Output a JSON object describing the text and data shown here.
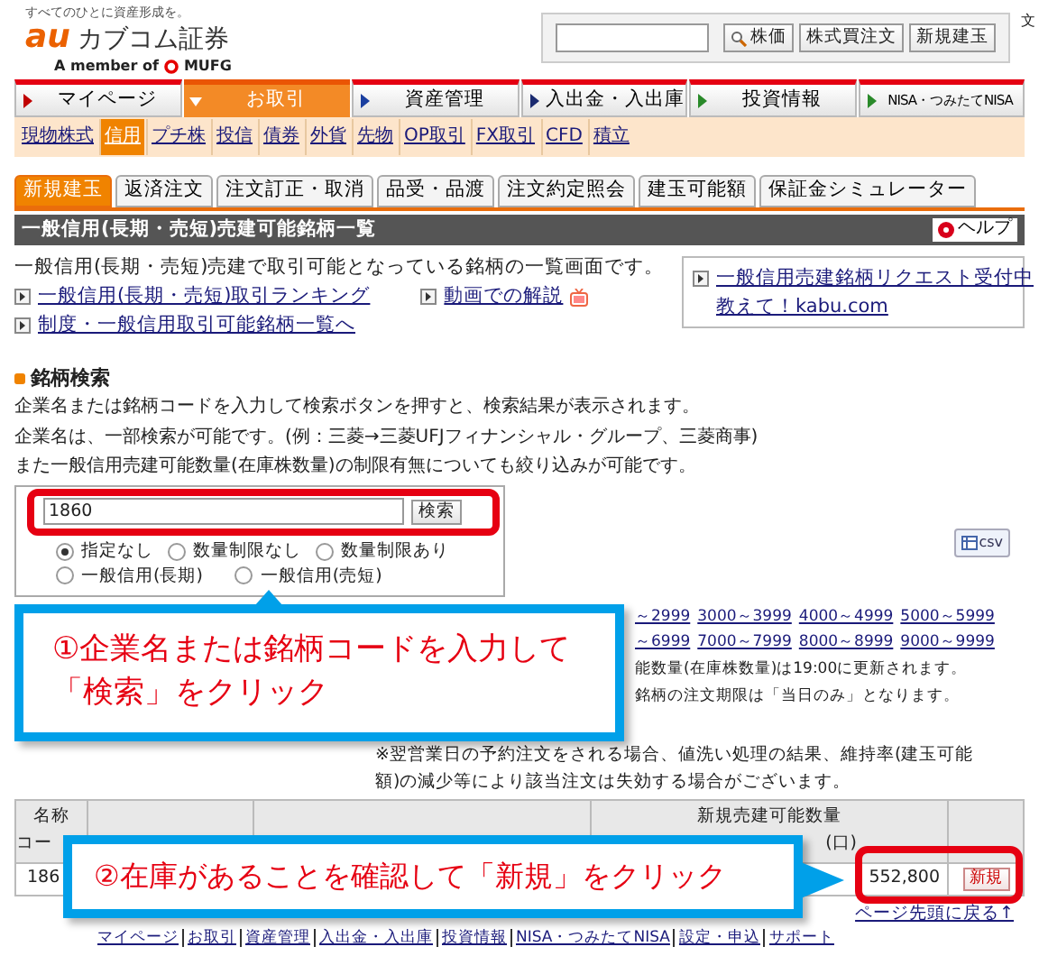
{
  "header": {
    "tagline": "すべてのひとに資産形成を。",
    "logo_mark": "au",
    "logo_text": "カブコム証券",
    "member_text": "A member of",
    "member_brand": "MUFG",
    "search_buttons": [
      "株価",
      "株式買注文",
      "新規建玉"
    ],
    "edge_texts": [
      "文"
    ]
  },
  "main_nav": [
    {
      "label": "マイページ",
      "selected": false,
      "color": "#c00000"
    },
    {
      "label": "お取引",
      "selected": true,
      "color": "#ffffff"
    },
    {
      "label": "資産管理",
      "selected": false,
      "color": "#1a3fa0"
    },
    {
      "label": "入出金・入出庫",
      "selected": false,
      "color": "#1a2a70"
    },
    {
      "label": "投資情報",
      "selected": false,
      "color": "#2a8a2a"
    },
    {
      "label": "NISA・つみたてNISA",
      "selected": false,
      "color": "#2a8a2a"
    }
  ],
  "sub_nav": [
    {
      "label": "現物株式",
      "selected": false
    },
    {
      "label": "信用",
      "selected": true
    },
    {
      "label": "プチ株",
      "selected": false
    },
    {
      "label": "投信",
      "selected": false
    },
    {
      "label": "債券",
      "selected": false
    },
    {
      "label": "外貨",
      "selected": false
    },
    {
      "label": "先物",
      "selected": false
    },
    {
      "label": "OP取引",
      "selected": false
    },
    {
      "label": "FX取引",
      "selected": false
    },
    {
      "label": "CFD",
      "selected": false
    },
    {
      "label": "積立",
      "selected": false
    }
  ],
  "tabs": [
    {
      "label": "新規建玉",
      "selected": true
    },
    {
      "label": "返済注文",
      "selected": false
    },
    {
      "label": "注文訂正・取消",
      "selected": false
    },
    {
      "label": "品受・品渡",
      "selected": false
    },
    {
      "label": "注文約定照会",
      "selected": false
    },
    {
      "label": "建玉可能額",
      "selected": false
    },
    {
      "label": "保証金シミュレーター",
      "selected": false
    }
  ],
  "page_title": "一般信用(長期・売短)売建可能銘柄一覧",
  "help_button": "ヘルプ",
  "intro": {
    "text": "一般信用(長期・売短)売建で取引可能となっている銘柄の一覧画面です。",
    "links": [
      "一般信用(長期・売短)取引ランキング",
      "動画での解説",
      "制度・一般信用取引可能銘柄一覧へ"
    ],
    "side_links": [
      "一般信用売建銘柄リクエスト受付中",
      "教えて！kabu.com"
    ]
  },
  "search": {
    "heading": "銘柄検索",
    "lines": [
      "企業名または銘柄コードを入力して検索ボタンを押すと、検索結果が表示されます。",
      "企業名は、一部検索が可能です。(例：三菱→三菱UFJフィナンシャル・グループ、三菱商事)",
      "また一般信用売建可能数量(在庫株数量)の制限有無についても絞り込みが可能です。"
    ],
    "value": "1860",
    "button": "検索",
    "filters": [
      {
        "label": "指定なし",
        "selected": true
      },
      {
        "label": "数量制限なし",
        "selected": false
      },
      {
        "label": "数量制限あり",
        "selected": false
      },
      {
        "label": "一般信用(長期)",
        "selected": false
      },
      {
        "label": "一般信用(売短)",
        "selected": false
      }
    ],
    "csv_button": "csv"
  },
  "callouts": [
    "①企業名または銘柄コードを入力して「検索」をクリック",
    "②在庫があることを確認して「新規」をクリック"
  ],
  "code_ranges": [
    "～2999",
    "3000～3999",
    "4000～4999",
    "5000～5999",
    "～6999",
    "7000～7999",
    "8000～8999",
    "9000～9999"
  ],
  "notes": [
    "能数量(在庫株数量)は19:00に更新されます。",
    "銘柄の注文期限は「当日のみ」となります。",
    "※翌営業日の予約注文をされる場合、値洗い処理の結果、維持率(建玉可能額)の減少等により該当注文は失効する場合がございます。"
  ],
  "table": {
    "header_1": [
      "名称",
      "コー"
    ],
    "header_4": "新規売建可能数量",
    "header_4_unit": "(口)",
    "rows": [
      {
        "code": "186",
        "quantity": "552,800",
        "button": "新規"
      }
    ]
  },
  "back_to_top": "ページ先頭に戻る↑",
  "footer_links": [
    "マイページ",
    "お取引",
    "資産管理",
    "入出金・入出庫",
    "投資情報",
    "NISA・つみたてNISA",
    "設定・申込",
    "サポート"
  ]
}
